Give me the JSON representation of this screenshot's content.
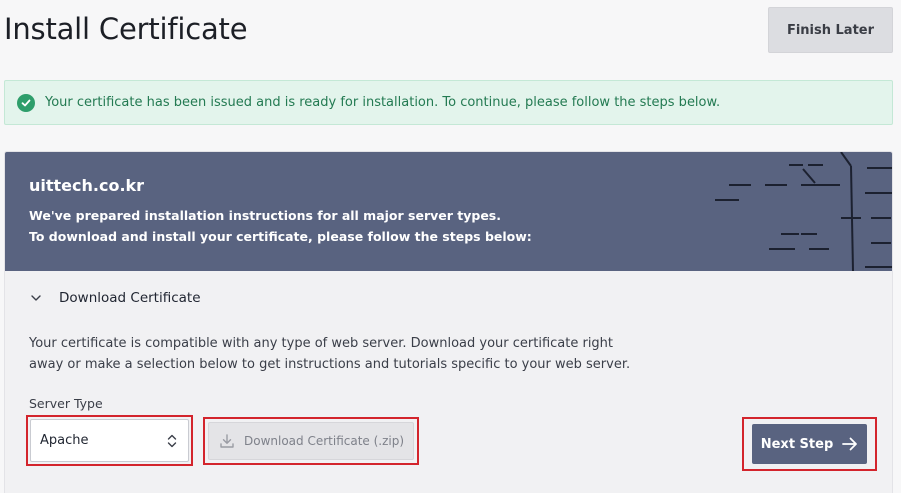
{
  "header": {
    "title": "Install Certificate",
    "finish_later_label": "Finish Later"
  },
  "alert": {
    "message": "Your certificate has been issued and is ready for installation. To continue, please follow the steps below.",
    "icon": "check-circle-icon",
    "color": "#2e9e6b"
  },
  "banner": {
    "domain": "uittech.co.kr",
    "line1": "We've prepared installation instructions for all major server types.",
    "line2": "To download and install your certificate, please follow the steps below:",
    "background": "#596380"
  },
  "section": {
    "title": "Download Certificate",
    "expanded": true,
    "description_line1": "Your certificate is compatible with any type of web server. Download your certificate right",
    "description_line2": "away or make a selection below to get instructions and tutorials specific to your web server."
  },
  "server_type": {
    "label": "Server Type",
    "selected": "Apache"
  },
  "download_button": {
    "label": "Download Certificate (.zip)",
    "icon": "download-icon",
    "disabled": true
  },
  "next_button": {
    "label": "Next Step",
    "icon": "arrow-right-icon"
  }
}
